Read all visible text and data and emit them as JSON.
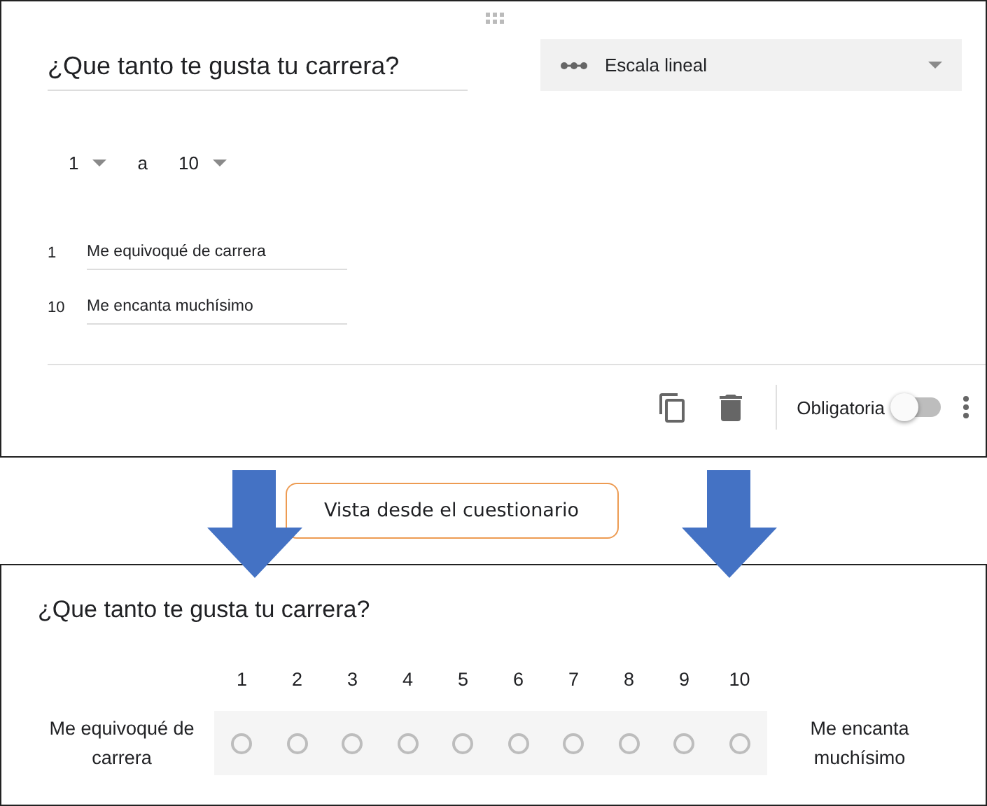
{
  "editor": {
    "question": "¿Que tanto te gusta tu carrera?",
    "question_type": "Escala lineal",
    "range": {
      "from": "1",
      "separator": "a",
      "to": "10"
    },
    "end_labels": [
      {
        "number": "1",
        "text": "Me equivoqué de carrera"
      },
      {
        "number": "10",
        "text": "Me encanta muchísimo"
      }
    ],
    "footer": {
      "required_label": "Obligatoria",
      "required_on": false
    }
  },
  "callout": "Vista desde el cuestionario",
  "preview": {
    "question": "¿Que tanto te gusta tu carrera?",
    "low_label": "Me equivoqué de carrera",
    "high_label": "Me encanta muchísimo",
    "options": [
      {
        "label": "1",
        "selected": false
      },
      {
        "label": "2",
        "selected": false
      },
      {
        "label": "3",
        "selected": false
      },
      {
        "label": "4",
        "selected": false
      },
      {
        "label": "5",
        "selected": false
      },
      {
        "label": "6",
        "selected": false
      },
      {
        "label": "7",
        "selected": false
      },
      {
        "label": "8",
        "selected": false
      },
      {
        "label": "9",
        "selected": false
      },
      {
        "label": "10",
        "selected": false
      }
    ]
  }
}
